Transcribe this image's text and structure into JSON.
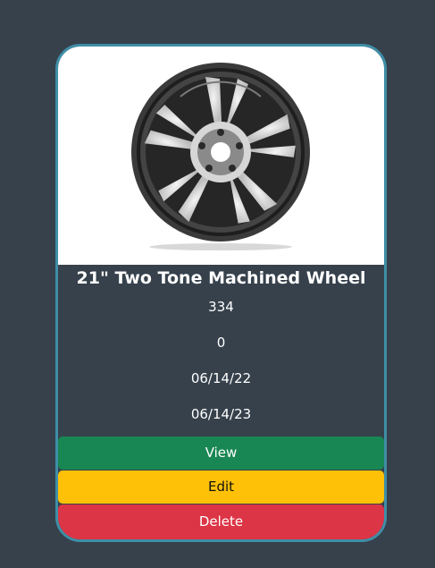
{
  "product": {
    "image_icon": "wheel-rim-icon",
    "title": "21\" Two Tone Machined Wheel",
    "fields": [
      "334",
      "0",
      "06/14/22",
      "06/14/23"
    ]
  },
  "actions": {
    "view_label": "View",
    "edit_label": "Edit",
    "delete_label": "Delete"
  },
  "colors": {
    "page_background": "#36414c",
    "card_border": "#3f8ea7",
    "view": "#198754",
    "edit": "#ffc107",
    "delete": "#dc3545"
  }
}
